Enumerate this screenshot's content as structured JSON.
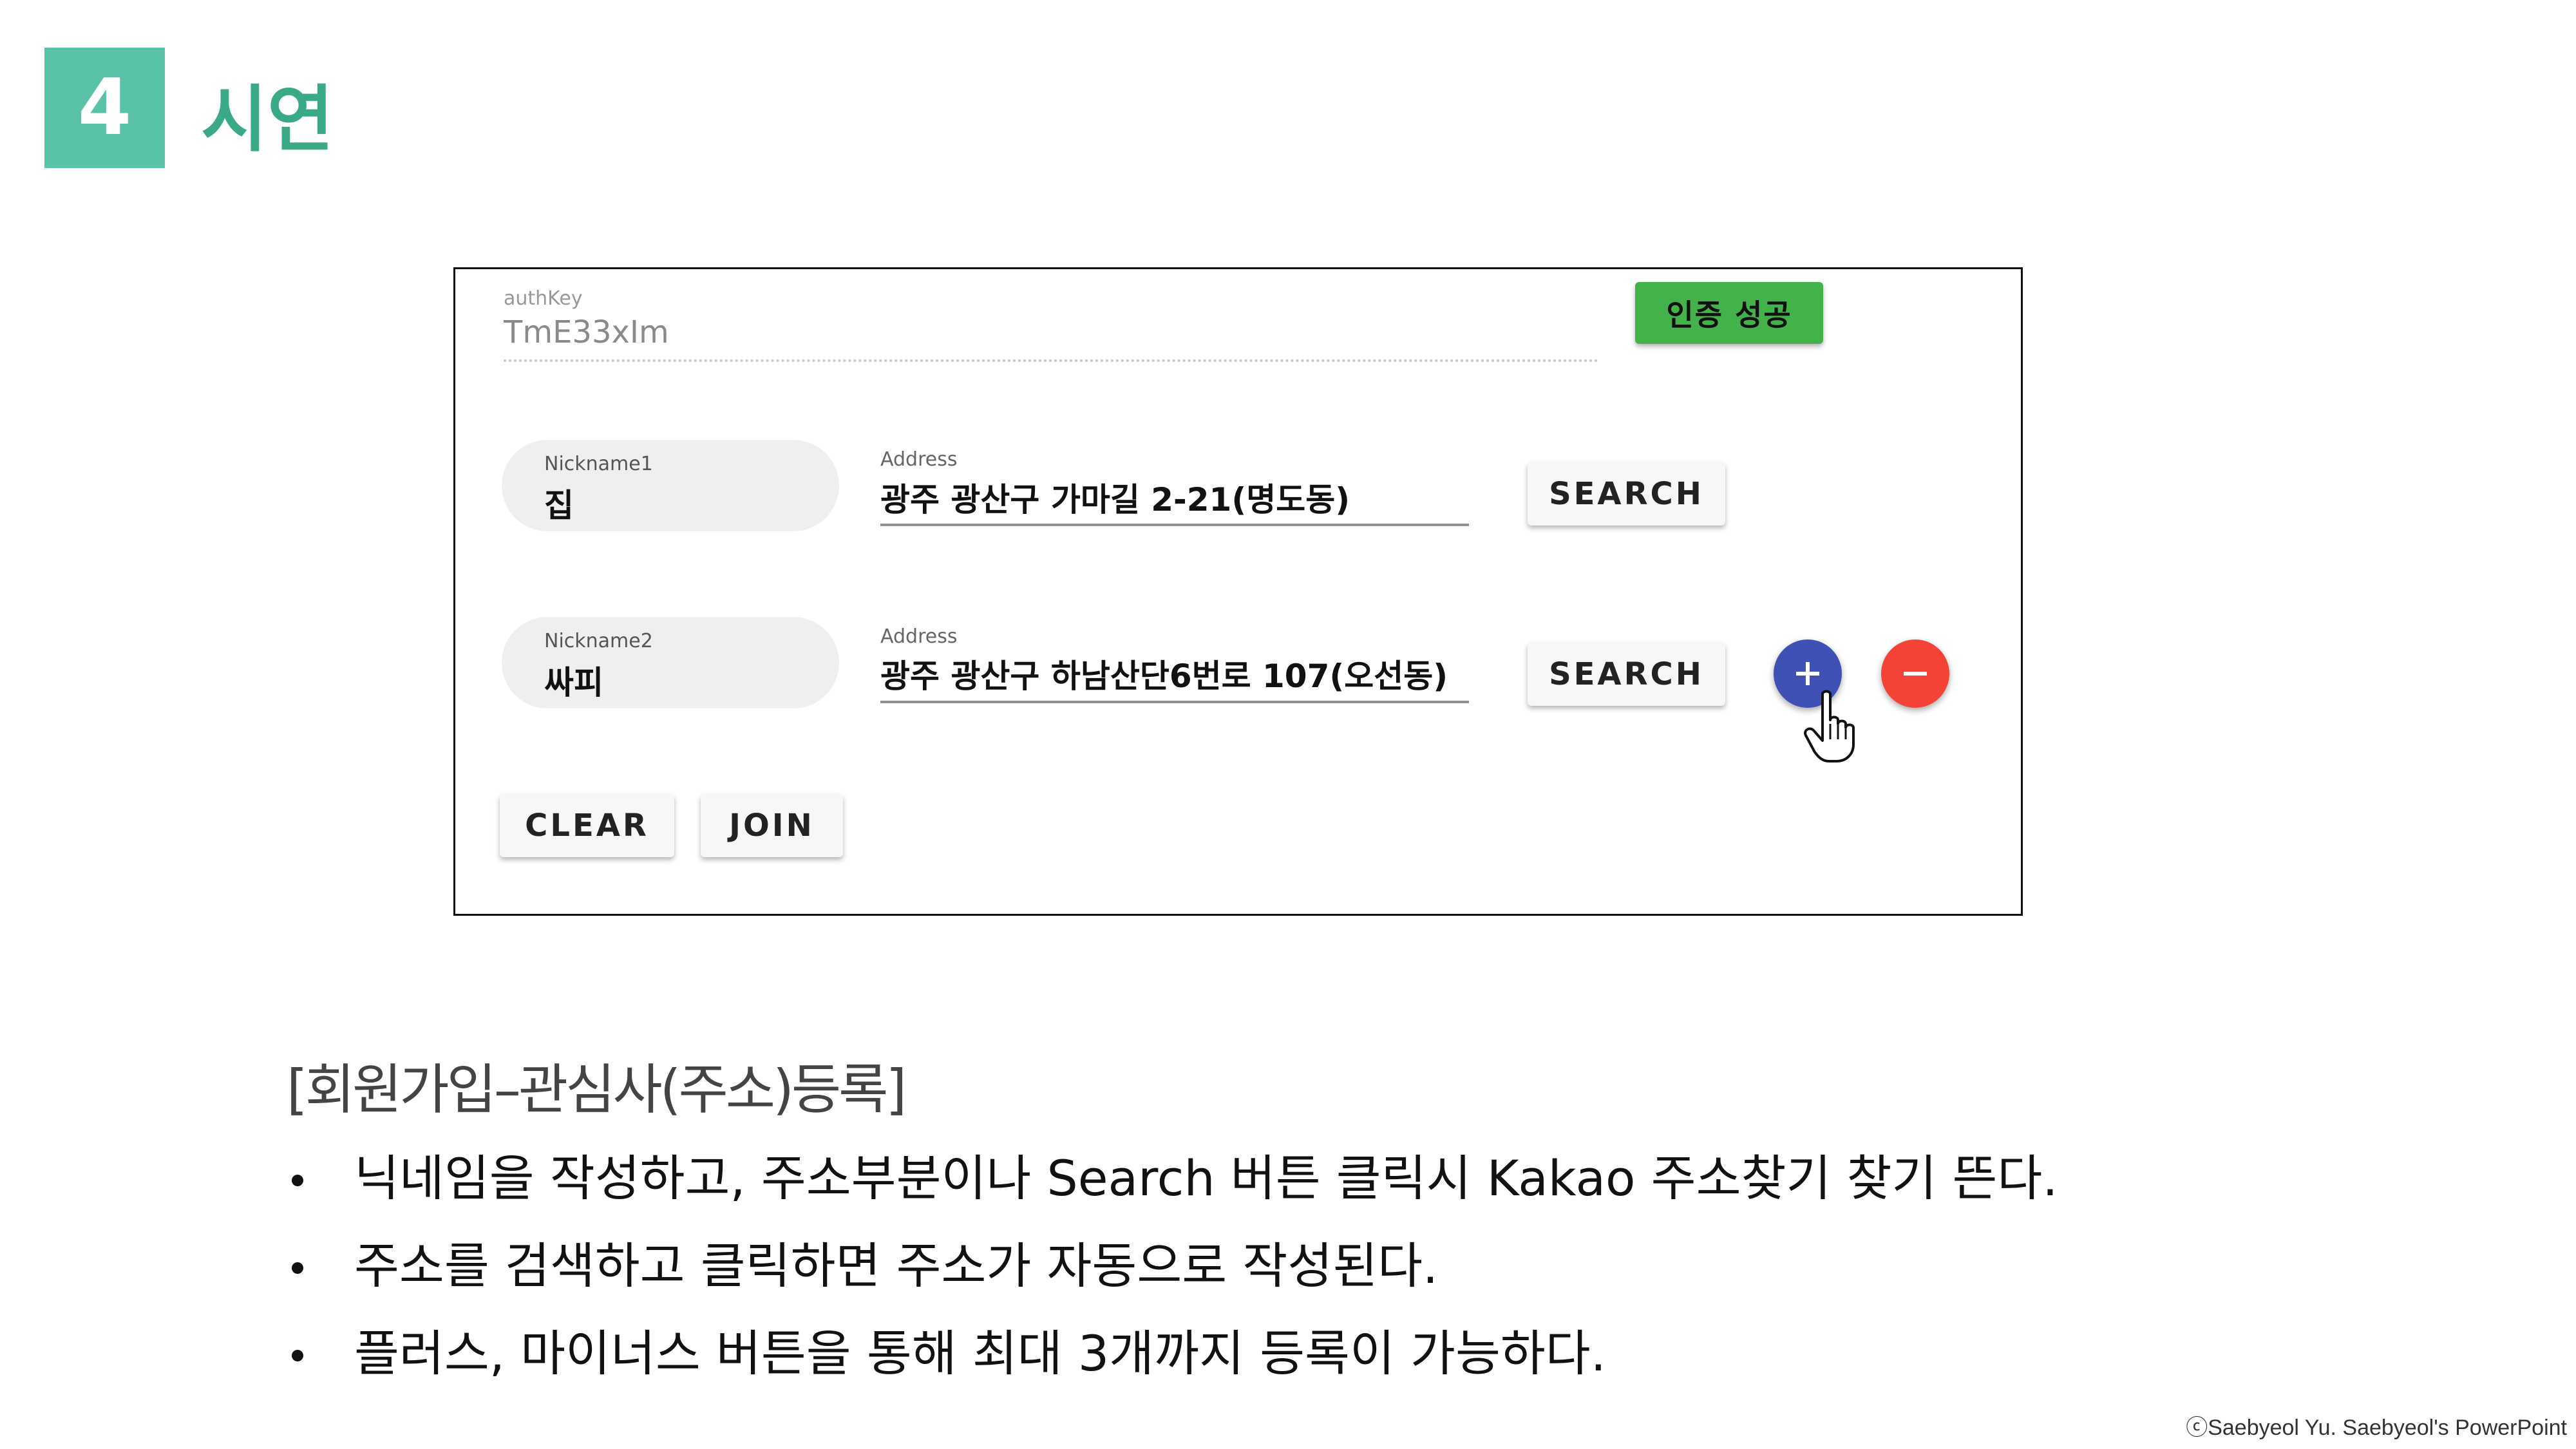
{
  "slide": {
    "number": "4",
    "title": "시연"
  },
  "screenshot": {
    "auth": {
      "label": "authKey",
      "value": "TmE33xIm",
      "button_label": "인증 성공",
      "button_color": "#44b24a"
    },
    "rows": [
      {
        "nickname_label": "Nickname1",
        "nickname_value": "집",
        "address_label": "Address",
        "address_value": "광주 광산구 가마길 2-21(명도동)",
        "search_label": "SEARCH"
      },
      {
        "nickname_label": "Nickname2",
        "nickname_value": "싸피",
        "address_label": "Address",
        "address_value": "광주 광산구 하남산단6번로 107(오선동)",
        "search_label": "SEARCH"
      }
    ],
    "add_button_icon": "plus-icon",
    "remove_button_icon": "minus-icon",
    "add_button_color": "#3f51b5",
    "remove_button_color": "#f44336",
    "clear_label": "CLEAR",
    "join_label": "JOIN"
  },
  "section_heading": "[회원가입–관심사(주소)등록]",
  "bullets": [
    "닉네임을 작성하고, 주소부분이나 Search 버튼 클릭시 Kakao 주소찾기 찾기 뜬다.",
    "주소를 검색하고 클릭하면 주소가 자동으로 작성된다.",
    "플러스, 마이너스 버튼을 통해 최대 3개까지 등록이 가능하다."
  ],
  "credit": "ⓒSaebyeol Yu. Saebyeol's PowerPoint"
}
